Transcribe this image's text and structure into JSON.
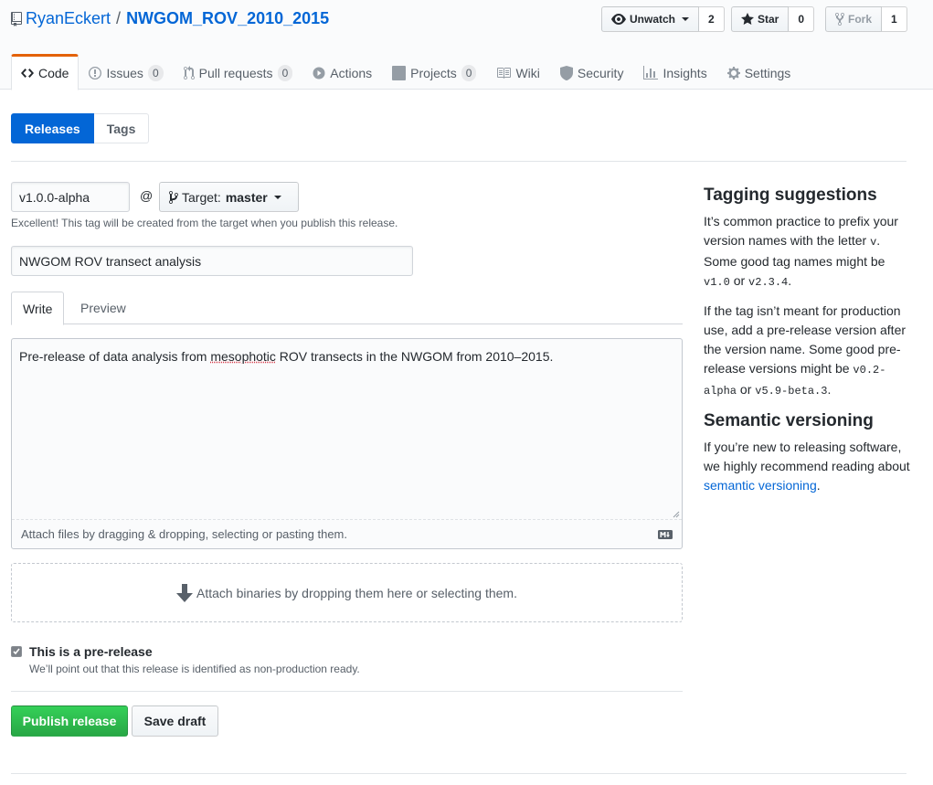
{
  "repo": {
    "owner": "RyanEckert",
    "separator": "/",
    "name": "NWGOM_ROV_2010_2015"
  },
  "actions": {
    "watch_label": "Unwatch",
    "watch_count": "2",
    "star_label": "Star",
    "star_count": "0",
    "fork_label": "Fork",
    "fork_count": "1"
  },
  "nav": {
    "code": "Code",
    "issues": "Issues",
    "issues_count": "0",
    "pulls": "Pull requests",
    "pulls_count": "0",
    "actions": "Actions",
    "projects": "Projects",
    "projects_count": "0",
    "wiki": "Wiki",
    "security": "Security",
    "insights": "Insights",
    "settings": "Settings"
  },
  "subnav": {
    "releases": "Releases",
    "tags": "Tags"
  },
  "form": {
    "tag_value": "v1.0.0-alpha",
    "at_symbol": "@",
    "target_label": "Target:",
    "target_branch": "master",
    "tag_note": "Excellent! This tag will be created from the target when you publish this release.",
    "title_value": "NWGOM ROV transect analysis",
    "tab_write": "Write",
    "tab_preview": "Preview",
    "body_before": "Pre-release of data analysis from ",
    "body_misspelled": "mesophotic",
    "body_after": " ROV transects in the NWGOM from 2010–2015.",
    "attach_files_note": "Attach files by dragging & dropping, selecting or pasting them.",
    "attach_binaries": "Attach binaries by dropping them here or selecting them.",
    "prerelease_label": "This is a pre-release",
    "prerelease_checked": true,
    "prerelease_note": "We’ll point out that this release is identified as non-production ready.",
    "publish_button": "Publish release",
    "draft_button": "Save draft"
  },
  "sidebar": {
    "tagging_title": "Tagging suggestions",
    "tagging_p1_a": "It’s common practice to prefix your version names with the letter ",
    "tagging_p1_code1": "v",
    "tagging_p1_b": ". Some good tag names might be ",
    "tagging_p1_code2": "v1.0",
    "tagging_p1_c": " or ",
    "tagging_p1_code3": "v2.3.4",
    "tagging_p1_d": ".",
    "tagging_p2_a": "If the tag isn’t meant for production use, add a pre-release version after the version name. Some good pre-release versions might be ",
    "tagging_p2_code1": "v0.2-alpha",
    "tagging_p2_b": " or ",
    "tagging_p2_code2": "v5.9-beta.3",
    "tagging_p2_c": ".",
    "semver_title": "Semantic versioning",
    "semver_p_a": "If you’re new to releasing software, we highly recommend reading about ",
    "semver_link": "semantic versioning",
    "semver_p_b": "."
  },
  "colors": {
    "accent_blue": "#0366d6",
    "selected_tab_orange": "#e36209",
    "publish_green": "#28a745"
  }
}
